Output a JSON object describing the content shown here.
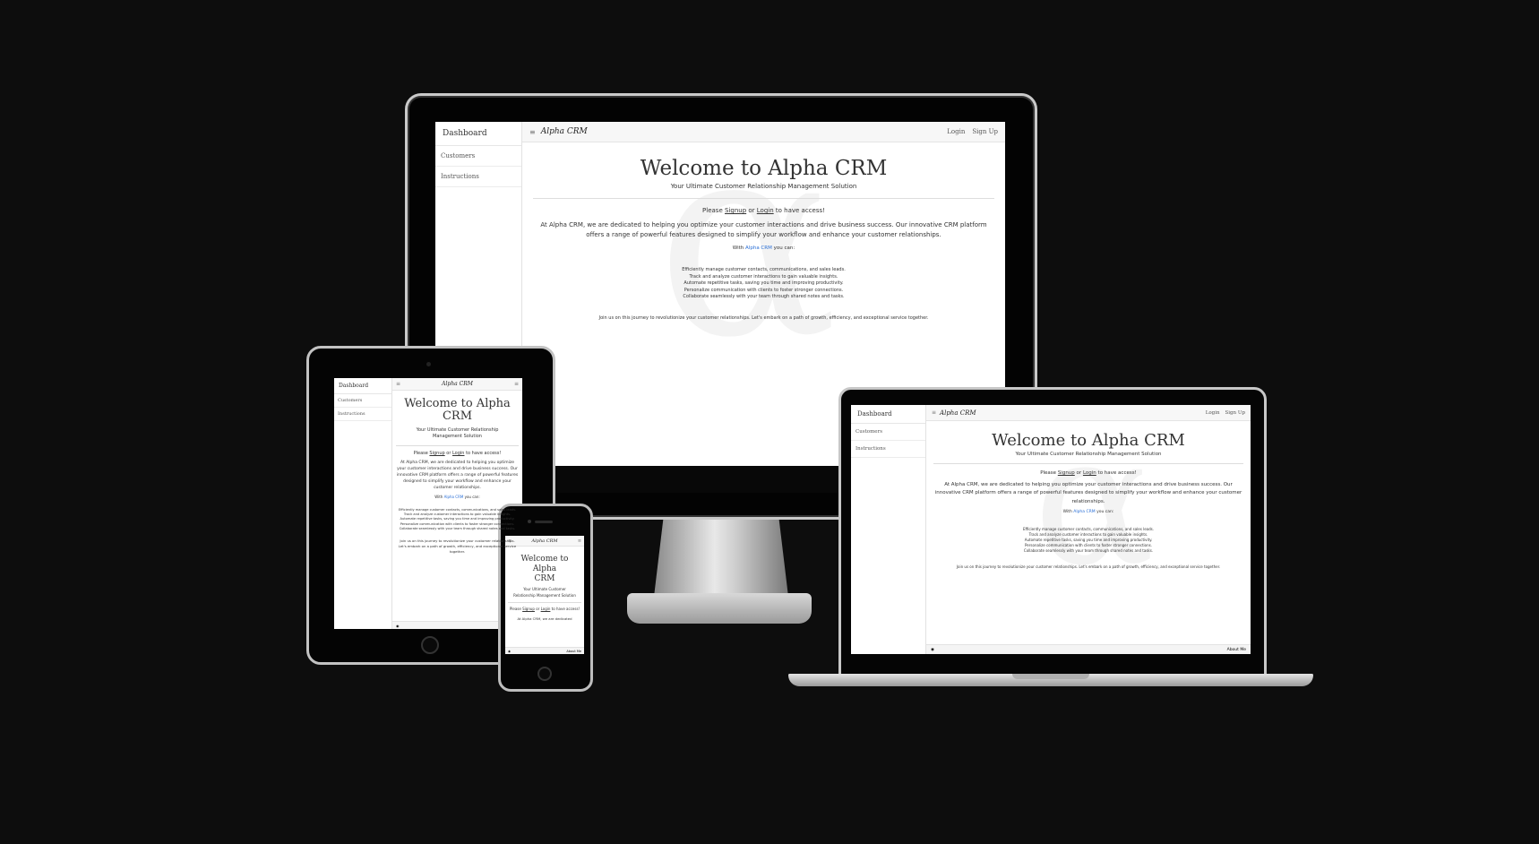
{
  "app": {
    "brand": "Alpha CRM",
    "sidebar": {
      "title": "Dashboard",
      "items": [
        "Customers",
        "Instructions"
      ]
    },
    "nav": {
      "login": "Login",
      "signup": "Sign Up"
    },
    "hero": {
      "title": "Welcome to Alpha CRM",
      "tablet_title_1": "Welcome to Alpha",
      "tablet_title_2": "CRM",
      "phone_title_1": "Welcome to Alpha",
      "phone_title_2": "CRM",
      "subtitle": "Your Ultimate Customer Relationship Management Solution"
    },
    "access": {
      "please": "Please",
      "signup": "Signup",
      "or": "or",
      "login": "Login",
      "rest": "to have access!"
    },
    "intro": "At Alpha CRM, we are dedicated to helping you optimize your customer interactions and drive business success. Our innovative CRM platform offers a range of powerful features designed to simplify your workflow and enhance your customer relationships.",
    "with": {
      "pre": "With",
      "link": "Alpha CRM",
      "post": "you can:"
    },
    "features": [
      "Efficiently manage customer contacts, communications, and sales leads.",
      "Track and analyze customer interactions to gain valuable insights.",
      "Automate repetitive tasks, saving you time and improving productivity.",
      "Personalize communication with clients to foster stronger connections.",
      "Collaborate seamlessly with your team through shared notes and tasks."
    ],
    "closing": "Join us on this journey to revolutionize your customer relationships. Let's embark on a path of growth, efficiency, and exceptional service together.",
    "footer": {
      "about": "About Me"
    },
    "watermark": "α",
    "phone_intro": "At Alpha CRM, we are dedicated"
  },
  "colors": {
    "background": "#0d0d0d",
    "link": "#2a6fd6",
    "topbar": "#f7f7f7"
  },
  "icons": {
    "menu": "hamburger-icon",
    "github": "github-icon",
    "camera": "camera-icon",
    "home": "home-button-icon"
  }
}
